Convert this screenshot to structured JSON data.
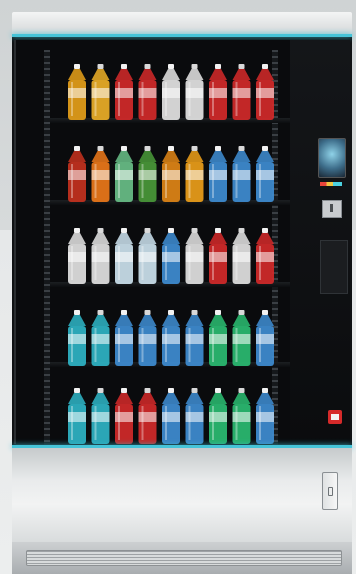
{
  "image": {
    "subject": "vending-machine",
    "colors": {
      "accent_light": "#46c4d8",
      "cabinet": "#101214",
      "steel": "#e9ebec",
      "background": "#d9dcdd"
    },
    "shelves": [
      {
        "bottles": [
          "#e9a21a",
          "#f0b128",
          "#d62a2a",
          "#d62a2a",
          "#e8e8e8",
          "#e8e8e8",
          "#d62a2a",
          "#d62a2a",
          "#d62a2a"
        ]
      },
      {
        "bottles": [
          "#c8321f",
          "#f07a1a",
          "#6ac28a",
          "#4a9b3a",
          "#e38716",
          "#f0a11a",
          "#3f8fd6",
          "#3f8fd6",
          "#3f8fd6"
        ]
      },
      {
        "bottles": [
          "#e6e6e6",
          "#e6e6e6",
          "#cfe5f2",
          "#cfe5f2",
          "#3f8fd6",
          "#e6e6e6",
          "#d62a2a",
          "#e6e6e6",
          "#d62a2a"
        ]
      },
      {
        "bottles": [
          "#2fb7c9",
          "#2fb7c9",
          "#3f8fd6",
          "#3f8fd6",
          "#3f8fd6",
          "#3f8fd6",
          "#2bbf73",
          "#2bbf73",
          "#3f8fd6"
        ]
      },
      {
        "bottles": [
          "#2fb7c9",
          "#2fb7c9",
          "#d62a2a",
          "#d62a2a",
          "#3f8fd6",
          "#3f8fd6",
          "#2bbf73",
          "#2bbf73",
          "#3f8fd6"
        ]
      }
    ]
  }
}
